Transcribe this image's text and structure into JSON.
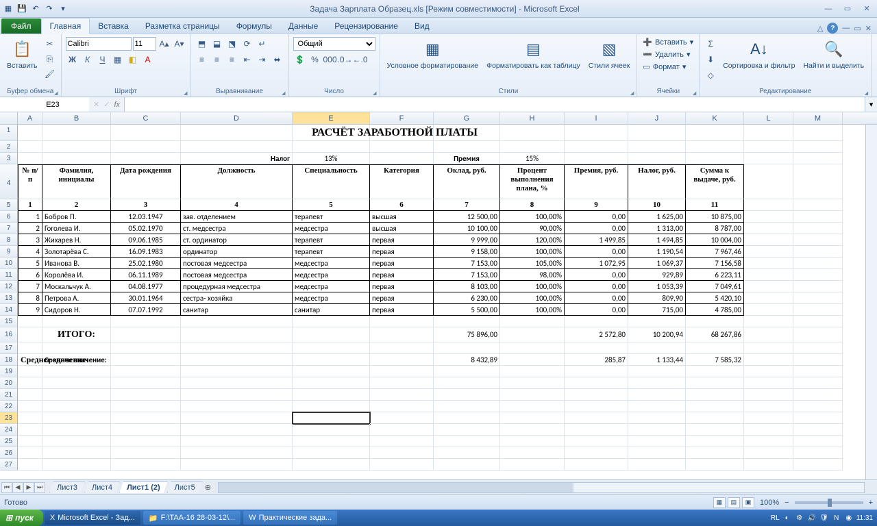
{
  "title": "Задача Зарплата Образец.xls  [Режим совместимости] - Microsoft Excel",
  "qat": {
    "save": "💾",
    "undo": "↶",
    "redo": "↷"
  },
  "win": {
    "min": "—",
    "max": "▭",
    "close": "✕",
    "rmin": "—",
    "rmax": "▭",
    "rclose": "✕"
  },
  "tabs": {
    "file": "Файл",
    "items": [
      "Главная",
      "Вставка",
      "Разметка страницы",
      "Формулы",
      "Данные",
      "Рецензирование",
      "Вид"
    ],
    "active": 0
  },
  "ribbon": {
    "clipboard": {
      "paste": "Вставить",
      "label": "Буфер обмена"
    },
    "font": {
      "name": "Calibri",
      "size": "11",
      "label": "Шрифт"
    },
    "align": {
      "label": "Выравнивание"
    },
    "number": {
      "fmt": "Общий",
      "label": "Число"
    },
    "styles": {
      "cond": "Условное форматирование",
      "table": "Форматировать как таблицу",
      "cell": "Стили ячеек",
      "label": "Стили"
    },
    "cells": {
      "ins": "Вставить",
      "del": "Удалить",
      "fmt": "Формат",
      "label": "Ячейки"
    },
    "editing": {
      "sort": "Сортировка и фильтр",
      "find": "Найти и выделить",
      "label": "Редактирование"
    }
  },
  "namebox": "E23",
  "title_cell": "РАСЧЁТ ЗАРАБОТНОЙ ПЛАТЫ",
  "r3": {
    "tax": "Налог",
    "tax_v": "13%",
    "bonus": "Премия",
    "bonus_v": "15%"
  },
  "headers": {
    "A": "№ п/п",
    "B": "Фамилия, инициалы",
    "C": "Дата рождения",
    "D": "Должность",
    "E": "Специальность",
    "F": "Категория",
    "G": "Оклад, руб.",
    "H": "Процент выполнения плана, %",
    "I": "Премия, руб.",
    "J": "Налог, руб.",
    "K": "Сумма к выдаче, руб."
  },
  "nums": {
    "A": "1",
    "B": "2",
    "C": "3",
    "D": "4",
    "E": "5",
    "F": "6",
    "G": "7",
    "H": "8",
    "I": "9",
    "J": "10",
    "K": "11"
  },
  "rows": [
    {
      "n": "1",
      "f": "Бобров П.",
      "d": "12.03.1947",
      "p": "зав. отделением",
      "s": "терапевт",
      "k": "высшая",
      "o": "12 500,00",
      "pl": "100,00%",
      "pr": "0,00",
      "t": "1 625,00",
      "sum": "10 875,00"
    },
    {
      "n": "2",
      "f": "Гоголева И.",
      "d": "05.02.1970",
      "p": "ст. медсестра",
      "s": "медсестра",
      "k": "высшая",
      "o": "10 100,00",
      "pl": "90,00%",
      "pr": "0,00",
      "t": "1 313,00",
      "sum": "8 787,00"
    },
    {
      "n": "3",
      "f": "Жихарев Н.",
      "d": "09.06.1985",
      "p": "ст. ординатор",
      "s": "терапевт",
      "k": "первая",
      "o": "9 999,00",
      "pl": "120,00%",
      "pr": "1 499,85",
      "t": "1 494,85",
      "sum": "10 004,00"
    },
    {
      "n": "4",
      "f": "Золотарёва С.",
      "d": "16.09.1983",
      "p": "ординатор",
      "s": "терапевт",
      "k": "первая",
      "o": "9 158,00",
      "pl": "100,00%",
      "pr": "0,00",
      "t": "1 190,54",
      "sum": "7 967,46"
    },
    {
      "n": "5",
      "f": "Иванова В.",
      "d": "25.02.1980",
      "p": "постовая медсестра",
      "s": "медсестра",
      "k": "первая",
      "o": "7 153,00",
      "pl": "105,00%",
      "pr": "1 072,95",
      "t": "1 069,37",
      "sum": "7 156,58"
    },
    {
      "n": "6",
      "f": "Королёва И.",
      "d": "06.11.1989",
      "p": "постовая медсестра",
      "s": "медсестра",
      "k": "первая",
      "o": "7 153,00",
      "pl": "98,00%",
      "pr": "0,00",
      "t": "929,89",
      "sum": "6 223,11"
    },
    {
      "n": "7",
      "f": "Москальчук А.",
      "d": "04.08.1977",
      "p": "процедурная медсестра",
      "s": "медсестра",
      "k": "первая",
      "o": "8 103,00",
      "pl": "100,00%",
      "pr": "0,00",
      "t": "1 053,39",
      "sum": "7 049,61"
    },
    {
      "n": "8",
      "f": "Петрова А.",
      "d": "30.01.1964",
      "p": "сестра- хозяйка",
      "s": "медсестра",
      "k": "первая",
      "o": "6 230,00",
      "pl": "100,00%",
      "pr": "0,00",
      "t": "809,90",
      "sum": "5 420,10"
    },
    {
      "n": "9",
      "f": "Сидоров Н.",
      "d": "07.07.1992",
      "p": "санитар",
      "s": "санитар",
      "k": "первая",
      "o": "5 500,00",
      "pl": "100,00%",
      "pr": "0,00",
      "t": "715,00",
      "sum": "4 785,00"
    }
  ],
  "totals": {
    "label": "ИТОГО:",
    "o": "75 896,00",
    "pr": "2 572,80",
    "t": "10 200,94",
    "sum": "68 267,86"
  },
  "avg": {
    "label": "Среднее значение:",
    "o": "8 432,89",
    "pr": "285,87",
    "t": "1 133,44",
    "sum": "7 585,32"
  },
  "sheets": {
    "items": [
      "Лист3",
      "Лист4",
      "Лист1 (2)",
      "Лист5"
    ],
    "active": 2
  },
  "status": {
    "ready": "Готово",
    "zoom": "100%"
  },
  "taskbar": {
    "start": "пуск",
    "tasks": [
      {
        "icon": "X",
        "label": "Microsoft Excel - Зад..."
      },
      {
        "icon": "📁",
        "label": "F:\\TAA-16 28-03-12\\..."
      },
      {
        "icon": "W",
        "label": "Практические зада..."
      }
    ],
    "lang": "RL",
    "time": "11:31"
  },
  "cols": {
    "A": 36,
    "B": 100,
    "C": 102,
    "D": 163,
    "E": 113,
    "F": 93,
    "G": 97,
    "H": 94,
    "I": 93,
    "J": 84,
    "K": 85,
    "L": 72,
    "M": 72
  }
}
